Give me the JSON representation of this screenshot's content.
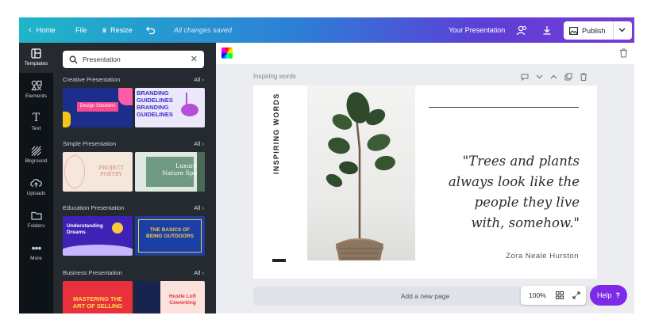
{
  "topbar": {
    "home": "Home",
    "file": "File",
    "resize": "Resize",
    "status": "All changes saved",
    "doc_title": "Your Presentation",
    "publish": "Publish"
  },
  "rail": [
    {
      "label": "Templates",
      "icon": "templates-icon"
    },
    {
      "label": "Elements",
      "icon": "elements-icon"
    },
    {
      "label": "Text",
      "icon": "text-icon"
    },
    {
      "label": "Bkground",
      "icon": "background-icon"
    },
    {
      "label": "Uploads",
      "icon": "uploads-icon"
    },
    {
      "label": "Folders",
      "icon": "folder-icon"
    },
    {
      "label": "More",
      "icon": "more-icon"
    }
  ],
  "search": {
    "value": "Presentation"
  },
  "sections": [
    {
      "title": "Creative Presentation",
      "all": "All",
      "thumbs": [
        "Design Solutions",
        "BRANDING GUIDELINES BRANDING GUIDELINES"
      ]
    },
    {
      "title": "Simple Presentation",
      "all": "All",
      "thumbs": [
        "PROJECT POETRY",
        "Luxure Nature Spa"
      ]
    },
    {
      "title": "Education Presentation",
      "all": "All",
      "thumbs": [
        "Understanding Dreams",
        "THE BASICS OF BEING OUTDOORS"
      ]
    },
    {
      "title": "Business Presentation",
      "all": "All",
      "thumbs": [
        "MASTERING THE ART OF SELLING",
        "Hustle Loft Coworking"
      ]
    }
  ],
  "canvas": {
    "page_label": "Inspiring words",
    "vertical_title": "INSPIRING WORDS",
    "quote": [
      "\"Trees and plants",
      "always look like the",
      "people they live",
      "with, somehow.\""
    ],
    "author": "Zora Neale Hurston",
    "add_page": "Add a new page",
    "zoom": "100%",
    "help": "Help",
    "help_mark": "?"
  },
  "colors": {
    "accent": "#7d2ae8",
    "rail_bg": "#0e1318",
    "panel_bg": "#252a31"
  }
}
